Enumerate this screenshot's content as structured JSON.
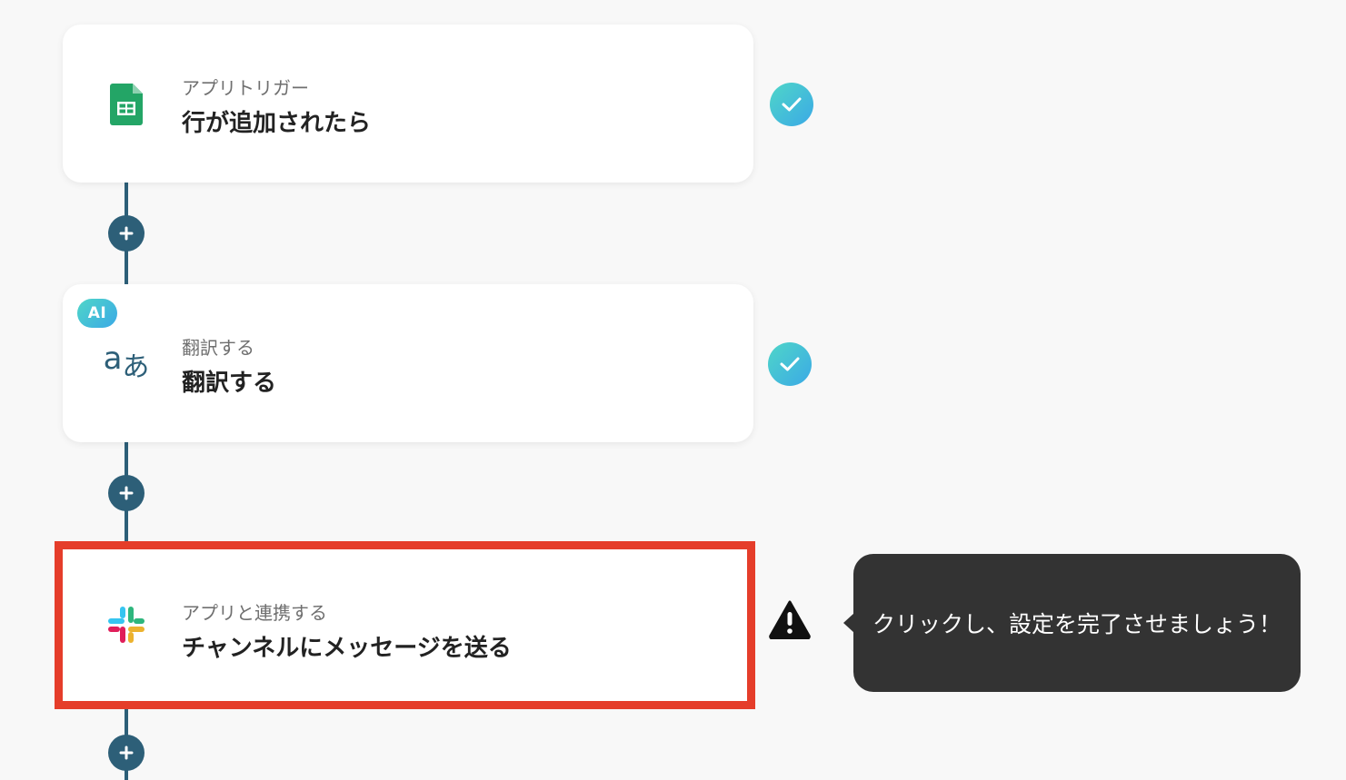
{
  "flow": {
    "steps": [
      {
        "subtitle": "アプリトリガー",
        "title": "行が追加されたら",
        "icon": "google-sheets-icon",
        "status": "complete"
      },
      {
        "badge": "AI",
        "subtitle": "翻訳する",
        "title": "翻訳する",
        "icon_glyph_latin": "a",
        "icon_glyph_kana": "あ",
        "icon": "translate-icon",
        "status": "complete"
      },
      {
        "subtitle": "アプリと連携する",
        "title": "チャンネルにメッセージを送る",
        "icon": "slack-icon",
        "status": "warning"
      }
    ],
    "tooltip": "クリックし、設定を完了させましょう！"
  },
  "colors": {
    "connector": "#2d5f78",
    "highlight_border": "#e53d2a",
    "check_gradient_start": "#4fd6c8",
    "check_gradient_end": "#3ba9e6",
    "tooltip_bg": "#333333",
    "page_bg": "#f8f8f8"
  }
}
